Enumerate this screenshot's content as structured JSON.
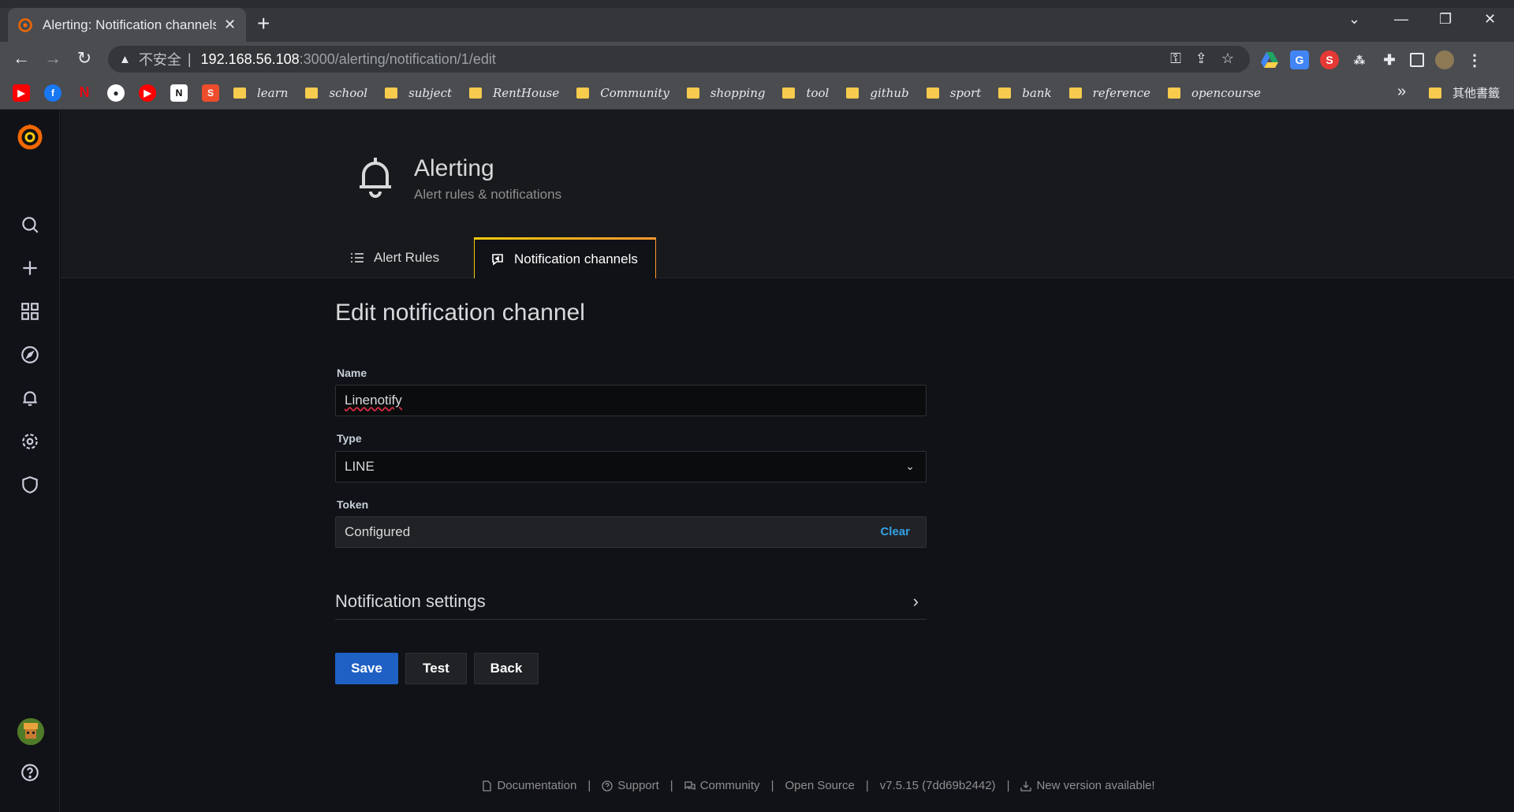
{
  "browser": {
    "tab_title": "Alerting: Notification channels",
    "tab_close": "✕",
    "new_tab": "+",
    "url_warning": "不安全",
    "url_host": "192.168.56.108",
    "url_path": ":3000/alerting/notification/1/edit",
    "window_controls": [
      "—",
      "❐",
      "✕"
    ],
    "bookmarks": [
      "learn",
      "school",
      "subject",
      "RentHouse",
      "Community",
      "shopping",
      "tool",
      "github",
      "sport",
      "bank",
      "reference",
      "opencourse"
    ],
    "bookmarks_more": "»",
    "other_bookmarks": "其他書籤"
  },
  "header": {
    "title": "Alerting",
    "subtitle": "Alert rules & notifications",
    "tabs": [
      {
        "label": "Alert Rules",
        "icon": "list-icon",
        "active": false
      },
      {
        "label": "Notification channels",
        "icon": "comment-alt-share-icon",
        "active": true
      }
    ]
  },
  "form": {
    "heading": "Edit notification channel",
    "name_label": "Name",
    "name_value": "Linenotify",
    "type_label": "Type",
    "type_value": "LINE",
    "token_label": "Token",
    "token_value": "Configured",
    "token_clear": "Clear",
    "notification_settings": "Notification settings",
    "save_label": "Save",
    "test_label": "Test",
    "back_label": "Back"
  },
  "footer": {
    "documentation": "Documentation",
    "support": "Support",
    "community": "Community",
    "open_source": "Open Source",
    "version": "v7.5.15 (7dd69b2442)",
    "new_version": "New version available!",
    "separator": "|"
  },
  "colors": {
    "primary_button": "#1f60c4",
    "link": "#33a2e5",
    "tab_accent": "#ff9830",
    "grafana_orange": "#f46800"
  }
}
